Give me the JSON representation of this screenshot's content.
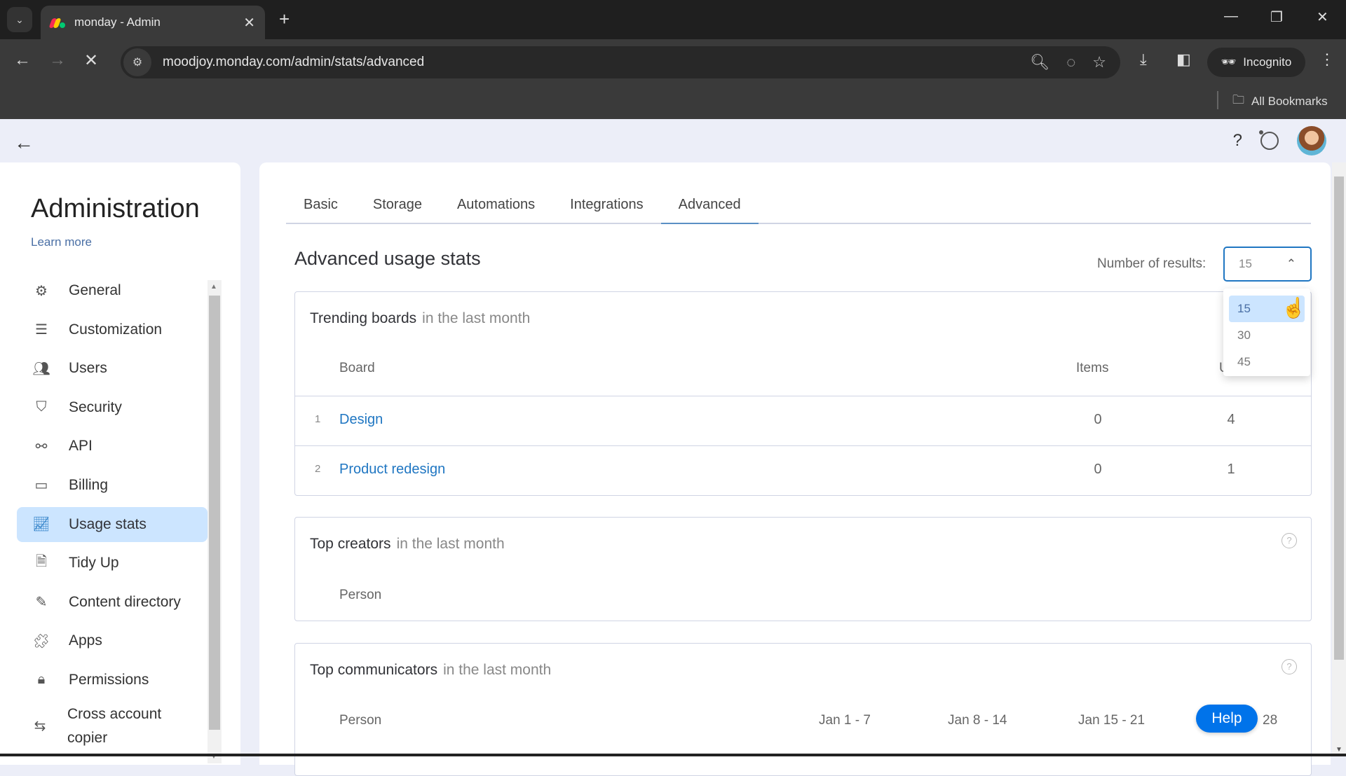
{
  "browser": {
    "tab_title": "monday - Admin",
    "url": "moodjoy.monday.com/admin/stats/advanced",
    "incognito_label": "Incognito",
    "bookmarks_label": "All Bookmarks",
    "new_tab_label": "+"
  },
  "header": {
    "help_label": "?"
  },
  "sidebar": {
    "title": "Administration",
    "learn_more": "Learn more",
    "items": [
      {
        "label": "General",
        "icon": "gear-icon"
      },
      {
        "label": "Customization",
        "icon": "sliders-icon"
      },
      {
        "label": "Users",
        "icon": "users-icon"
      },
      {
        "label": "Security",
        "icon": "shield-icon"
      },
      {
        "label": "API",
        "icon": "api-icon"
      },
      {
        "label": "Billing",
        "icon": "credit-card-icon"
      },
      {
        "label": "Usage stats",
        "icon": "chart-icon",
        "active": true
      },
      {
        "label": "Tidy Up",
        "icon": "shredder-icon"
      },
      {
        "label": "Content directory",
        "icon": "doc-edit-icon"
      },
      {
        "label": "Apps",
        "icon": "puzzle-icon"
      },
      {
        "label": "Permissions",
        "icon": "lock-icon"
      },
      {
        "label": "Cross account copier",
        "icon": "swap-icon"
      }
    ]
  },
  "main": {
    "tabs": [
      {
        "label": "Basic"
      },
      {
        "label": "Storage"
      },
      {
        "label": "Automations"
      },
      {
        "label": "Integrations"
      },
      {
        "label": "Advanced",
        "active": true
      }
    ],
    "title": "Advanced usage stats",
    "results": {
      "label": "Number of results:",
      "selected": "15",
      "options": [
        "15",
        "30",
        "45"
      ]
    },
    "trending": {
      "title": "Trending boards",
      "subtitle": "in the last month",
      "columns": [
        "Board",
        "Items",
        "U"
      ],
      "rows": [
        {
          "index": "1",
          "board": "Design",
          "items": "0",
          "updates": "4"
        },
        {
          "index": "2",
          "board": "Product redesign",
          "items": "0",
          "updates": "1"
        }
      ]
    },
    "creators": {
      "title": "Top creators",
      "subtitle": "in the last month",
      "columns": [
        "Person"
      ]
    },
    "communicators": {
      "title": "Top communicators",
      "subtitle": "in the last month",
      "columns": [
        "Person",
        "Jan 1 - 7",
        "Jan 8 - 14",
        "Jan 15 - 21",
        "28"
      ]
    },
    "help_button": "Help"
  }
}
